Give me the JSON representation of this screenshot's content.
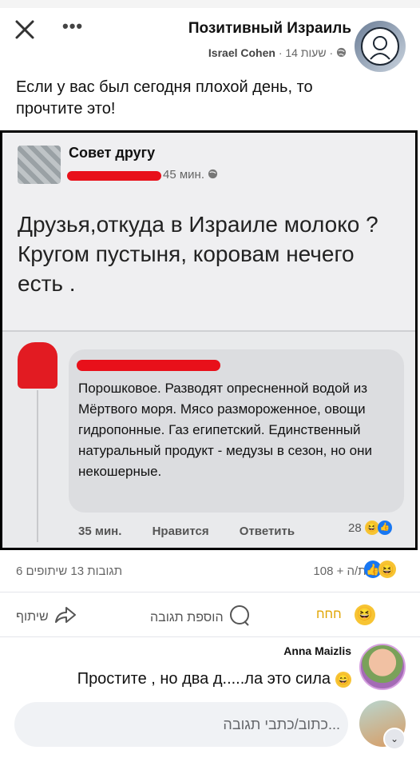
{
  "header": {
    "page_name": "Позитивный Израиль",
    "author": "Israel Cohen",
    "time": "14 שעות",
    "privacy_icon": "globe-icon",
    "close_icon": "close-icon",
    "more_icon": "more-icon"
  },
  "post": {
    "text": "Если у вас был сегодня плохой день, то прочтите это!"
  },
  "screenshot": {
    "group_name": "Совет другу",
    "time": "45 мин.",
    "body": "Друзья,откуда в Израиле молоко ? Кругом пустыня, коровам нечего есть .",
    "comment": {
      "text": "Порошковое. Разводят опресненной водой из Мёртвого моря. Мясо размороженное, овощи гидропонные. Газ египетский. Единственный натуральный продукт - медузы в сезон, но они некошерные.",
      "time": "35 мин.",
      "like": "Нравится",
      "reply": "Ответить",
      "reactions": "28"
    }
  },
  "stats": {
    "comments_shares": "6 תגובות 13 שיתופים",
    "reactions": "108 + את/ה"
  },
  "actions": {
    "share": "שיתוף",
    "comment": "הוספת תגובה",
    "react": "חחח"
  },
  "comment": {
    "name": "Anna Maizlis",
    "text": "Простите , но два д.....ла это сила"
  },
  "input": {
    "placeholder": "כתוב/כתבי תגובה..."
  },
  "colors": {
    "like_blue": "#1877f2",
    "haha_yellow": "#f7c433",
    "redaction_red": "#e8101a"
  }
}
